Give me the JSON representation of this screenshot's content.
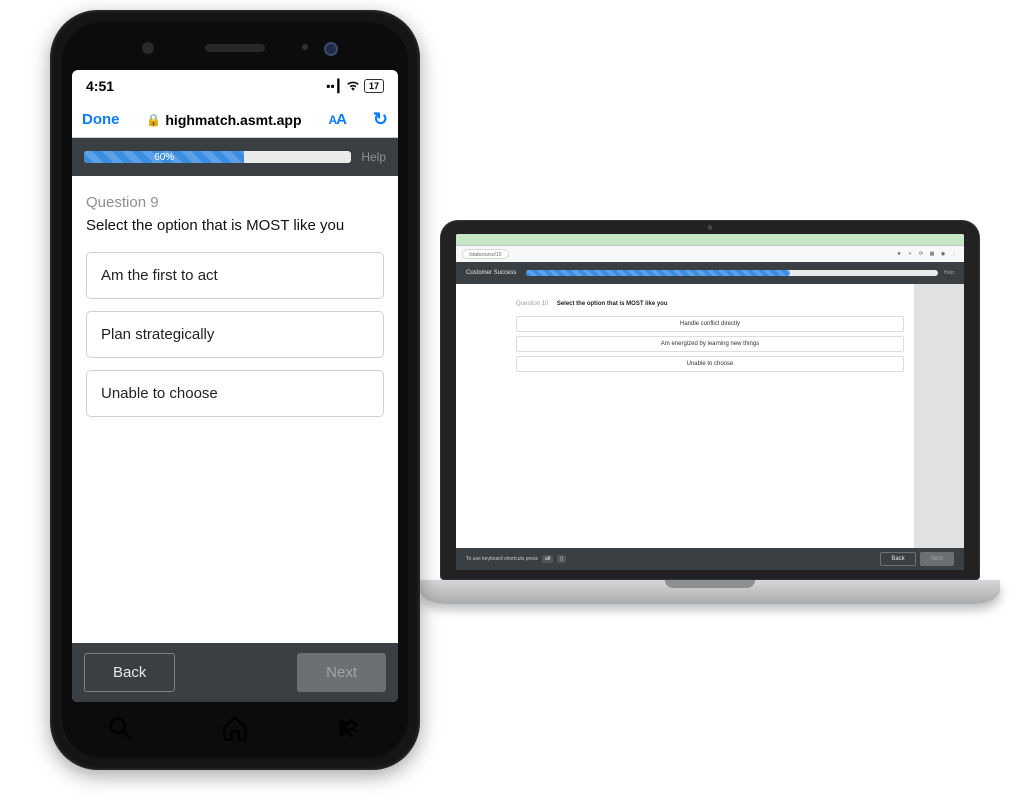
{
  "phone": {
    "status": {
      "time": "4:51",
      "battery_label": "17"
    },
    "safari": {
      "done_label": "Done",
      "url_host": "highmatch.asmt.app",
      "text_resize_label": "AA",
      "reload_label": "↻"
    },
    "header": {
      "progress_pct": 60,
      "progress_label": "60%",
      "help_label": "Help"
    },
    "question": {
      "number_label": "Question 9",
      "prompt": "Select the option that is MOST like you",
      "options": [
        "Am the first to act",
        "Plan strategically",
        "Unable to choose"
      ]
    },
    "footer": {
      "back_label": "Back",
      "next_label": "Next"
    }
  },
  "laptop": {
    "addr_text": "/staticourso/10",
    "header": {
      "title": "Customer Success",
      "progress_pct": 64,
      "progress_label": "64%",
      "help_label": "Help"
    },
    "question": {
      "number_label": "Question 10",
      "prompt": "Select the option that is MOST like you",
      "options": [
        "Handle conflict directly",
        "Am energized by learning new things",
        "Unable to choose"
      ]
    },
    "footer": {
      "kbd_hint": "To use keyboard shortcuts press",
      "kbd_key": "alt",
      "back_label": "Back",
      "next_label": "Next"
    }
  }
}
